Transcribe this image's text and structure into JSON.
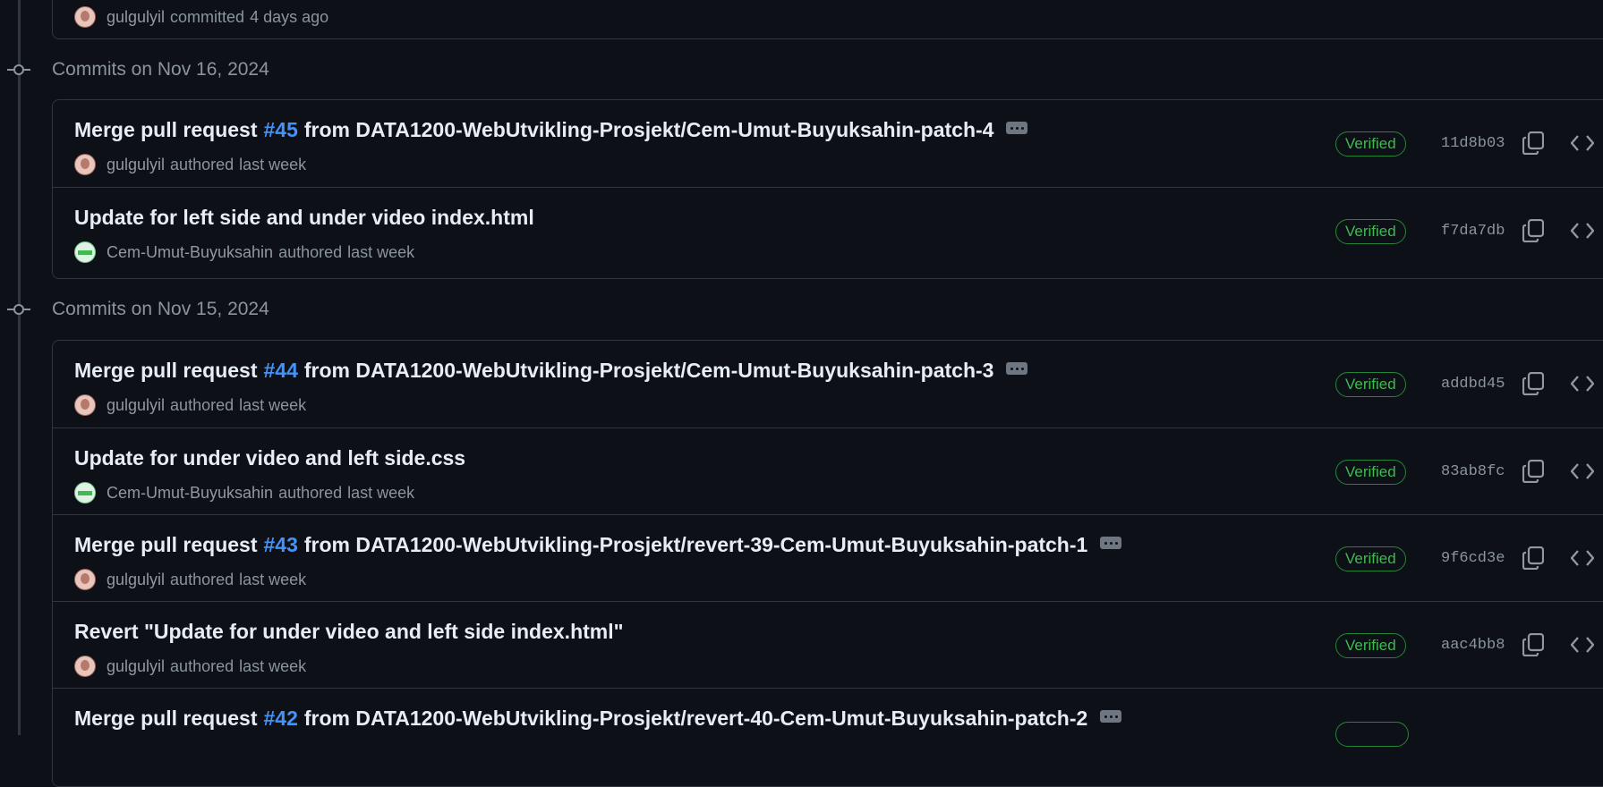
{
  "top_fragment": {
    "author": "gulgulyil",
    "action": "committed",
    "time": "4 days ago"
  },
  "groups": [
    {
      "title": "Commits on Nov 16, 2024",
      "commits": [
        {
          "prefix": "Merge pull request",
          "pr": "#45",
          "suffix": "from DATA1200-WebUtvikling-Prosjekt/Cem-Umut-Buyuksahin-patch-4",
          "has_ellipsis": true,
          "author": "gulgulyil",
          "action": "authored",
          "time": "last week",
          "avatar": "pink",
          "badge": "Verified",
          "sha": "11d8b03"
        },
        {
          "prefix": "Update for left side and under video index.html",
          "pr": "",
          "suffix": "",
          "has_ellipsis": false,
          "author": "Cem-Umut-Buyuksahin",
          "action": "authored",
          "time": "last week",
          "avatar": "green",
          "badge": "Verified",
          "sha": "f7da7db"
        }
      ]
    },
    {
      "title": "Commits on Nov 15, 2024",
      "commits": [
        {
          "prefix": "Merge pull request",
          "pr": "#44",
          "suffix": "from DATA1200-WebUtvikling-Prosjekt/Cem-Umut-Buyuksahin-patch-3",
          "has_ellipsis": true,
          "author": "gulgulyil",
          "action": "authored",
          "time": "last week",
          "avatar": "pink",
          "badge": "Verified",
          "sha": "addbd45"
        },
        {
          "prefix": "Update for under video and left side.css",
          "pr": "",
          "suffix": "",
          "has_ellipsis": false,
          "author": "Cem-Umut-Buyuksahin",
          "action": "authored",
          "time": "last week",
          "avatar": "green",
          "badge": "Verified",
          "sha": "83ab8fc"
        },
        {
          "prefix": "Merge pull request",
          "pr": "#43",
          "suffix": "from DATA1200-WebUtvikling-Prosjekt/revert-39-Cem-Umut-Buyuksahin-patch-1",
          "has_ellipsis": true,
          "author": "gulgulyil",
          "action": "authored",
          "time": "last week",
          "avatar": "pink",
          "badge": "Verified",
          "sha": "9f6cd3e"
        },
        {
          "prefix": "Revert \"Update for under video and left side index.html\"",
          "pr": "",
          "suffix": "",
          "has_ellipsis": false,
          "author": "gulgulyil",
          "action": "authored",
          "time": "last week",
          "avatar": "pink",
          "badge": "Verified",
          "sha": "aac4bb8"
        },
        {
          "prefix": "Merge pull request",
          "pr": "#42",
          "suffix": "from DATA1200-WebUtvikling-Prosjekt/revert-40-Cem-Umut-Buyuksahin-patch-2",
          "has_ellipsis": true,
          "author": "",
          "action": "",
          "time": "",
          "avatar": "",
          "badge": "",
          "sha": ""
        }
      ]
    }
  ],
  "colors": {
    "background": "#0d1117",
    "border": "#30363d",
    "link": "#4493f8",
    "verified": "#3fb950"
  },
  "icons": {
    "commit_node": "git-commit-icon",
    "copy": "copy-icon",
    "browse": "code-icon",
    "more": "ellipsis-icon"
  }
}
